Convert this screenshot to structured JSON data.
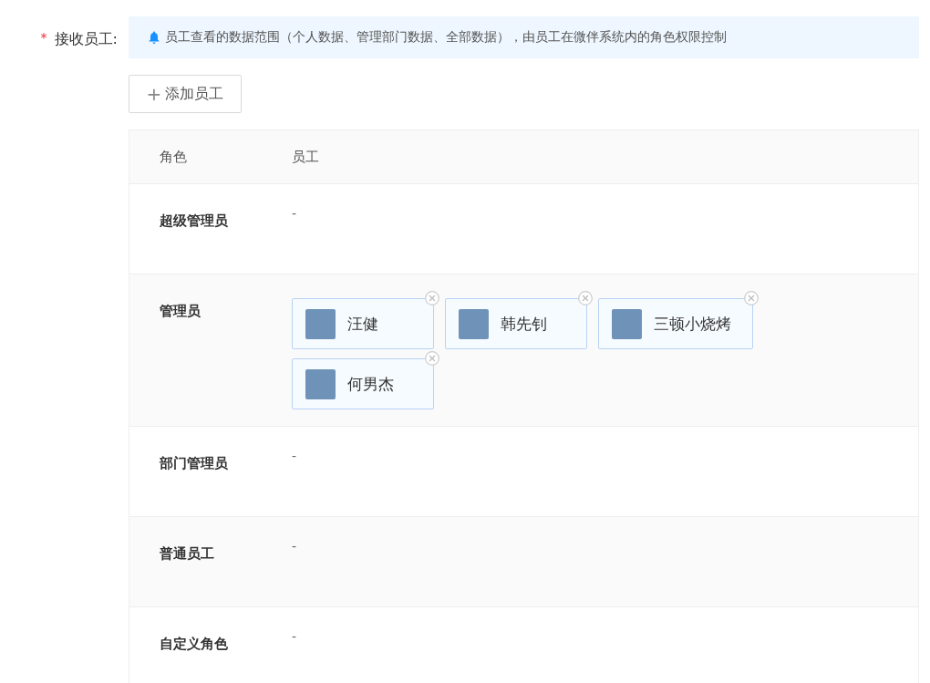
{
  "field": {
    "required_mark": "*",
    "label": "接收员工:"
  },
  "notice": {
    "text": "员工查看的数据范围（个人数据、管理部门数据、全部数据），由员工在微伴系统内的角色权限控制"
  },
  "add_button": {
    "icon": "+",
    "label": "添加员工"
  },
  "table": {
    "columns": [
      "角色",
      "员工"
    ],
    "rows": [
      {
        "role": "超级管理员",
        "empty_text": "-",
        "employees": []
      },
      {
        "role": "管理员",
        "employees": [
          {
            "name": "汪健"
          },
          {
            "name": "韩先钊"
          },
          {
            "name": "三顿小烧烤"
          },
          {
            "name": "何男杰"
          }
        ]
      },
      {
        "role": "部门管理员",
        "empty_text": "-",
        "employees": []
      },
      {
        "role": "普通员工",
        "empty_text": "-",
        "employees": []
      },
      {
        "role": "自定义角色",
        "empty_text": "-",
        "employees": []
      }
    ]
  }
}
